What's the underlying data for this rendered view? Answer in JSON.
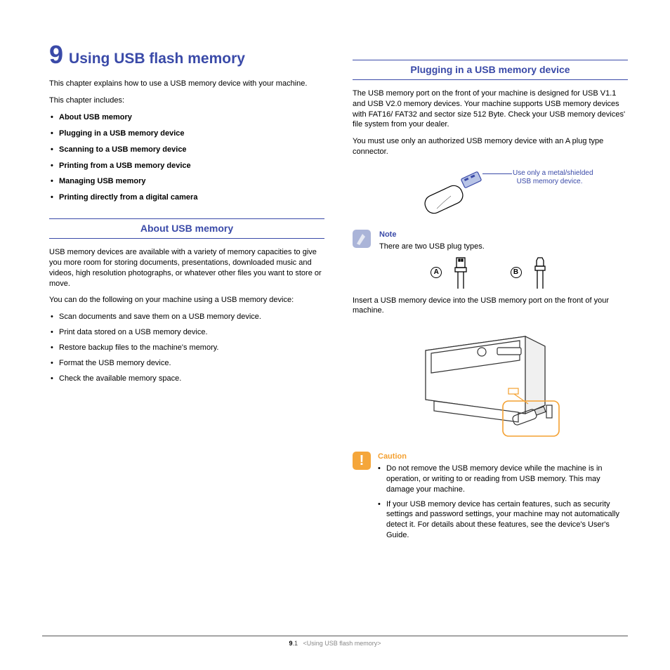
{
  "chapter": {
    "number": "9",
    "title": "Using USB flash memory"
  },
  "intro": "This chapter explains how to use a USB memory device with your machine.",
  "includes_label": "This chapter includes:",
  "toc": [
    "About USB memory",
    "Plugging in a USB memory device",
    "Scanning to a USB memory device",
    "Printing from a USB memory device",
    "Managing USB memory",
    "Printing directly from a digital camera"
  ],
  "section1": {
    "heading": "About USB memory",
    "p1": "USB memory devices are available with a variety of memory capacities to give you more room for storing documents, presentations, downloaded music and videos, high resolution photographs, or whatever other files you want to store or move.",
    "p2": "You can do the following on your machine using a USB memory device:",
    "items": [
      "Scan documents and save them on a USB memory device.",
      "Print data stored on a USB memory device.",
      "Restore backup files to the machine's memory.",
      "Format the USB memory device.",
      "Check the available memory space."
    ]
  },
  "section2": {
    "heading": "Plugging in a USB memory device",
    "p1": "The USB memory port on the front of your machine is designed for USB V1.1 and USB V2.0 memory devices. Your machine supports USB memory devices with FAT16/ FAT32 and sector size 512 Byte. Check your USB memory devices' file system from your dealer.",
    "p2": "You must use only an authorized USB memory device with an A plug type connector.",
    "callout_l1": "Use only a metal/shielded",
    "callout_l2": "USB memory device.",
    "note_head": "Note",
    "note_body": "There are two USB plug types.",
    "plug_a": "A",
    "plug_b": "B",
    "p3": "Insert a USB memory device into the USB memory port on the front of your machine.",
    "caution_head": "Caution",
    "caution_items": [
      "Do not remove the USB memory device while the machine is in operation, or writing to or reading from USB memory. This may damage your machine.",
      "If your USB memory device has certain features, such as security settings and password settings, your machine may not automatically detect it. For details about these features, see the device's User's Guide."
    ]
  },
  "footer": {
    "page_major": "9",
    "page_minor": ".1",
    "title": "<Using USB flash memory>"
  }
}
